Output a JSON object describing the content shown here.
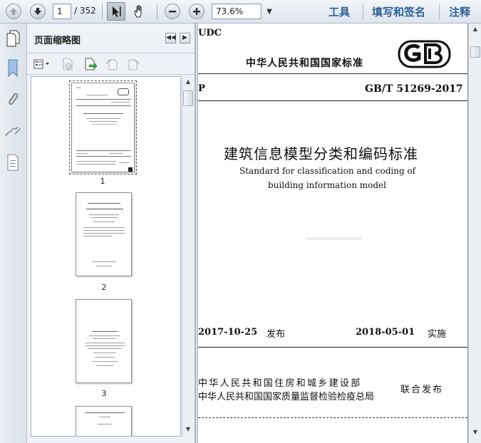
{
  "toolbar": {
    "current_page": "1",
    "total_pages": "/ 352",
    "zoom": "73.6%",
    "tools_label": "工具",
    "fill_sign_label": "填写和签名",
    "comment_label": "注释"
  },
  "panel": {
    "title": "页面缩略图",
    "thumbnails": [
      {
        "page_label": "1"
      },
      {
        "page_label": "2"
      },
      {
        "page_label": "3"
      }
    ]
  },
  "document": {
    "udc": "UDC",
    "national_standard": "中华人民共和国国家标准",
    "p_mark": "P",
    "standard_number": "GB/T 51269-2017",
    "title_cn": "建筑信息模型分类和编码标准",
    "title_en_line1": "Standard for classification and coding of",
    "title_en_line2": "building information model",
    "issue_date": "2017-10-25",
    "issue_label": "发布",
    "implement_date": "2018-05-01",
    "implement_label": "实施",
    "issuer_1": "中华人民共和国住房和城乡建设部",
    "issuer_2": "中华人民共和国国家质量监督检验检疫总局",
    "joint_issue": "联合发布"
  },
  "colors": {
    "toolbar_link": "#2d5f97",
    "panel_bg": "#eef2f7",
    "doc_gutter": "#8a8f96"
  }
}
